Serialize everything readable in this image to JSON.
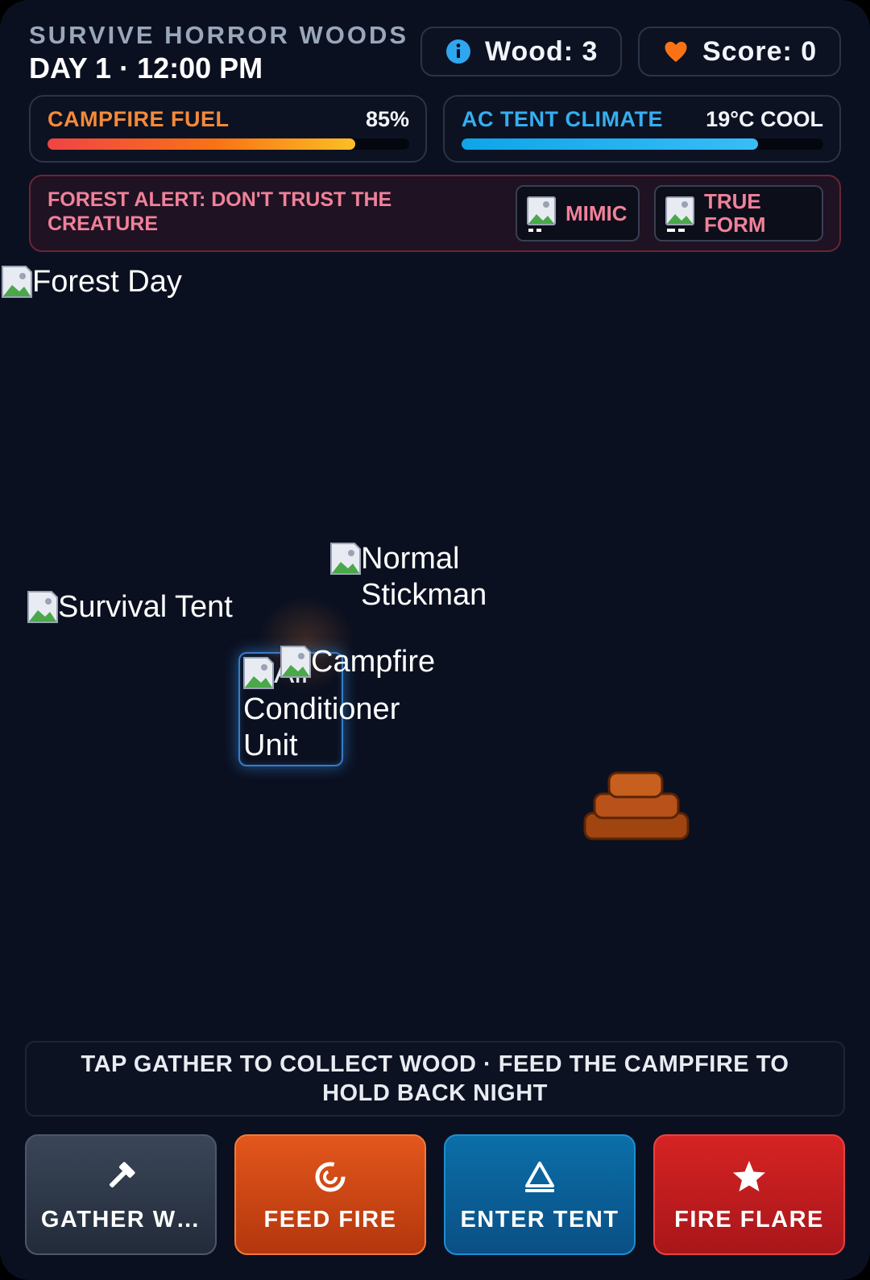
{
  "header": {
    "title": "SURVIVE HORROR WOODS",
    "clock": "DAY 1 · 12:00 PM",
    "wood_label": "Wood: 3",
    "wood_icon": "info-icon",
    "score_label": "Score: 0",
    "score_icon": "heart-icon"
  },
  "meters": {
    "fuel": {
      "label": "CAMPFIRE FUEL",
      "value_text": "85%",
      "level": 0.85,
      "color": "#f48a3a"
    },
    "ac": {
      "label": "AC TENT CLIMATE",
      "value_text": "19°C COOL",
      "level": 0.82,
      "color": "#35aef0"
    }
  },
  "alert": {
    "text": "FOREST ALERT: DON'T TRUST THE CREATURE",
    "chips": [
      {
        "label": "MIMIC"
      },
      {
        "label": "TRUE FORM"
      }
    ]
  },
  "scene": {
    "background_alt": "Forest Day",
    "stickman_alt": "Normal Stickman",
    "tent_alt": "Survival Tent",
    "campfire_alt": "Campfire",
    "ac_alt": "Air Conditioner Unit",
    "ac_alt_visible": "Conditioner Unit"
  },
  "hint": "TAP GATHER TO COLLECT WOOD · FEED THE CAMPFIRE TO HOLD BACK NIGHT",
  "actions": {
    "gather": "GATHER W…",
    "feed": "FEED FIRE",
    "tent": "ENTER TENT",
    "flare": "FIRE FLARE"
  }
}
